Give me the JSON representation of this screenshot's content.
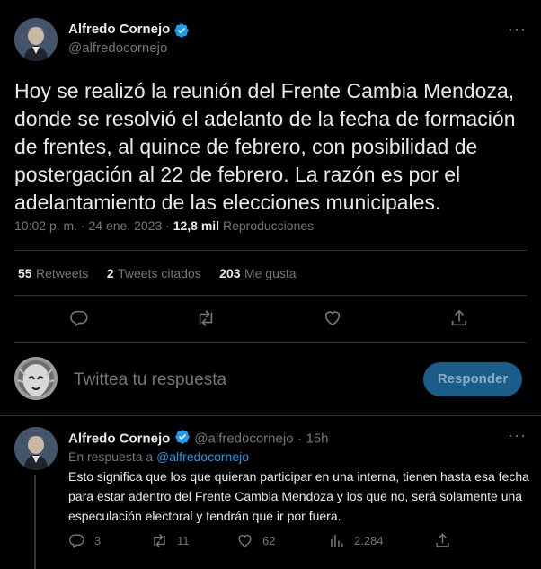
{
  "main_tweet": {
    "author_name": "Alfredo Cornejo",
    "author_handle": "@alfredocornejo",
    "more_label": "···",
    "text": "Hoy se realizó la reunión del Frente Cambia Mendoza, donde se resolvió el adelanto de la fecha de formación de frentes, al quince de febrero, con posibilidad de postergación al 22 de febrero. La razón es por el adelantamiento de las elecciones municipales.",
    "time": "10:02 p. m.",
    "sep": "·",
    "date": "24 ene. 2023",
    "views_count": "12,8 mil",
    "views_label": "Reproducciones",
    "stats": {
      "retweets_count": "55",
      "retweets_label": "Retweets",
      "quotes_count": "2",
      "quotes_label": "Tweets citados",
      "likes_count": "203",
      "likes_label": "Me gusta"
    }
  },
  "composer": {
    "placeholder": "Twittea tu respuesta",
    "button_label": "Responder"
  },
  "reply_tweet": {
    "author_name": "Alfredo Cornejo",
    "author_handle": "@alfredocornejo",
    "age": "15h",
    "sep": "·",
    "more_label": "···",
    "replying_prefix": "En respuesta a",
    "replying_to": "@alfredocornejo",
    "text": "Esto significa que los que quieran participar en una interna, tienen hasta esa fecha para estar adentro del Frente Cambia Mendoza y los que no, será solamente una especulación electoral y  tendrán que ir por fuera.",
    "counts": {
      "replies": "3",
      "retweets": "11",
      "likes": "62",
      "views": "2.284"
    }
  },
  "colors": {
    "background": "#000000",
    "accent": "#1d9bf0",
    "text_primary": "#e7e9ea",
    "text_secondary": "#71767b",
    "divider": "#2f3336"
  }
}
